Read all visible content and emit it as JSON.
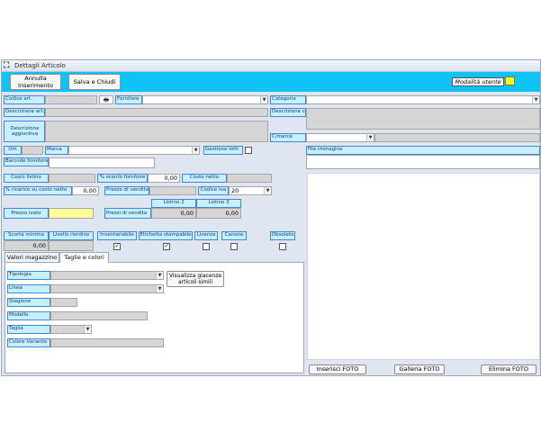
{
  "window": {
    "title": "Dettagli Articolo",
    "title_icon": "form-icon"
  },
  "toolbar": {
    "cancel_label": "Annulla\nInserimento",
    "save_close_label": "Salva e Chiudi",
    "user_mode_label": "Modalità utente",
    "user_mode_color": "#ffff00",
    "bar_color": "#0fc4f4"
  },
  "labels": {
    "codice_art": "Codice art.",
    "fornitore": "Fornitore",
    "categoria": "Categoria",
    "descrizione_art": "Descrizione art.",
    "descrizione_cat": "Descrizione cat.",
    "descrizione_aggiuntiva": "Descrizione aggiuntiva",
    "cmerce": "C/merce",
    "um": "Um",
    "marca": "Marca",
    "gestione_lotti": "Gestione lotti",
    "file_immagine": "File immagine",
    "barcode_fornitore": "Barcode fornitore",
    "costo_listino": "Costo listino",
    "sconto_fornitore": "% sconto fornitore",
    "costo_netto": "Costo netto",
    "ricarico": "% ricarico su costo netto",
    "prezzo_vendita": "Prezzo di vendita",
    "codice_iva": "Codice Iva",
    "listino2": "Listino 2",
    "listino3": "Listino 3",
    "prezzo_ivato": "Prezzo ivato",
    "prezzi_vendita": "Prezzi di vendita",
    "scorta_minima": "Scorta minima",
    "livello_riordino": "Livello riordino",
    "inventariabile": "Inventariabile",
    "etichetta_stampabile": "Etichetta stampabile",
    "licenza": "Licenza",
    "canone": "Canone",
    "obsoleto": "Obsoleto"
  },
  "values": {
    "sconto_fornitore": "0,00",
    "ricarico": "0,00",
    "codice_iva": "20",
    "listino2": "0,00",
    "listino3": "0,00",
    "scorta_minima": "0,00"
  },
  "checkboxes": {
    "gestione_lotti": false,
    "inventariabile": true,
    "etichetta_stampabile": true,
    "licenza": false,
    "canone": false,
    "obsoleto": false
  },
  "tabs": [
    {
      "label": "Valori magazzino",
      "active": false
    },
    {
      "label": "Taglie e colori",
      "active": true
    }
  ],
  "tab_panel": {
    "tipologia": "Tipologia",
    "linea": "Linea",
    "stagione": "Stagione",
    "modello": "Modello",
    "taglia": "Taglia",
    "colore_variante": "Colore Variante",
    "giacenze_button": "Visualizza giacenze\narticoli simili"
  },
  "footer": {
    "inserisci_foto": "Inserisci FOTO",
    "galleria_foto": "Galleria FOTO",
    "elimina_foto": "Elimina FOTO"
  }
}
